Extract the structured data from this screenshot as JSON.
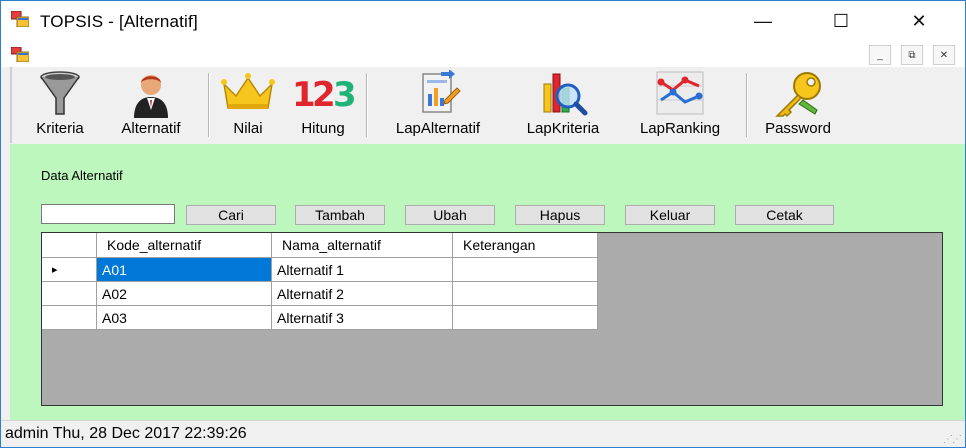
{
  "window": {
    "title": "TOPSIS - [Alternatif]",
    "minimize_symbol": "—",
    "maximize_symbol": "☐",
    "close_symbol": "✕"
  },
  "mdi": {
    "minimize_symbol": "_",
    "restore_symbol": "⧉",
    "close_symbol": "✕"
  },
  "toolbar": {
    "items": [
      {
        "label": "Kriteria",
        "icon": "funnel-icon"
      },
      {
        "label": "Alternatif",
        "icon": "person-icon"
      },
      {
        "label": "Nilai",
        "icon": "crown-icon"
      },
      {
        "label": "Hitung",
        "icon": "numbers-123-icon"
      },
      {
        "label": "LapAlternatif",
        "icon": "report-document-icon"
      },
      {
        "label": "LapKriteria",
        "icon": "report-search-icon"
      },
      {
        "label": "LapRanking",
        "icon": "ranking-chart-icon"
      },
      {
        "label": "Password",
        "icon": "key-icon"
      }
    ]
  },
  "main": {
    "section_title": "Data Alternatif",
    "search": {
      "value": "",
      "placeholder": ""
    },
    "buttons": {
      "cari": "Cari",
      "tambah": "Tambah",
      "ubah": "Ubah",
      "hapus": "Hapus",
      "keluar": "Keluar",
      "cetak": "Cetak"
    },
    "table": {
      "columns": [
        "Kode_alternatif",
        "Nama_alternatif",
        "Keterangan"
      ],
      "rows": [
        {
          "kode": "A01",
          "nama": "Alternatif 1",
          "keterangan": ""
        },
        {
          "kode": "A02",
          "nama": "Alternatif 2",
          "keterangan": ""
        },
        {
          "kode": "A03",
          "nama": "Alternatif 3",
          "keterangan": ""
        }
      ],
      "selected_row_index": 0,
      "row_indicator": "▸"
    }
  },
  "statusbar": {
    "text": "admin Thu, 28 Dec 2017 22:39:26"
  },
  "colors": {
    "client_background": "#bdf7bd",
    "selection": "#0078d7",
    "grid_background": "#ababab"
  }
}
